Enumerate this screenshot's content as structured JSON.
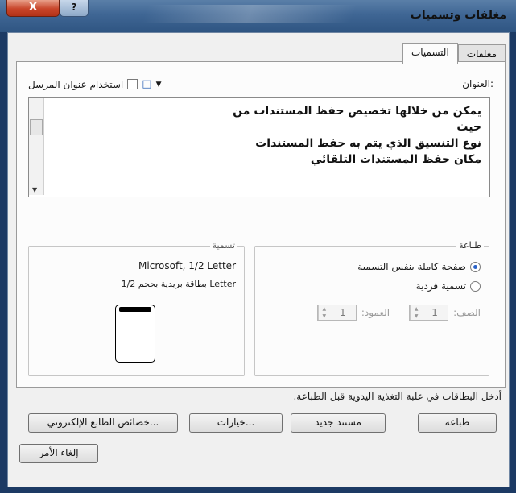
{
  "window": {
    "title": "مغلفات وتسميات",
    "close_label": "X",
    "help_label": "?"
  },
  "tabs": [
    {
      "label": "مغلفات",
      "active": false
    },
    {
      "label": "التسميات",
      "active": true
    }
  ],
  "address": {
    "label": "العنوان:",
    "use_return_address_label": "استخدام عنوان المرسل",
    "use_return_address_checked": false,
    "address_book_icon": "address-book-icon",
    "lines": [
      "يمكن من خلالها تخصيص حفظ المستندات من",
      "حيث",
      "نوع التنسيق الذي يتم به حفظ المستندات",
      "مكان حفظ المستندات التلقائي"
    ]
  },
  "print": {
    "group_title": "طباعة",
    "options": [
      {
        "label": "صفحة كاملة بنفس التسمية",
        "selected": true
      },
      {
        "label": "تسمية فردية",
        "selected": false
      }
    ],
    "row_label": "الصف:",
    "row_value": "1",
    "column_label": "العمود:",
    "column_value": "1"
  },
  "label": {
    "group_title": "تسمية",
    "product": "Microsoft, 1/2 Letter",
    "description": "بطاقة بريدية بحجم 1/2 Letter"
  },
  "info_text": "أدخل البطاقات في علبة التغذية اليدوية قبل الطباعة.",
  "buttons": {
    "print": "طباعة",
    "new_document": "مستند جديد",
    "options": "خيارات...",
    "epostage": "خصائص الطابع الإلكتروني...",
    "cancel": "إلغاء الأمر"
  },
  "colors": {
    "titlebar": "#3f6694",
    "close": "#c8452a",
    "dialog_bg": "#f0f0f0",
    "radio_on": "#2a62c8"
  }
}
